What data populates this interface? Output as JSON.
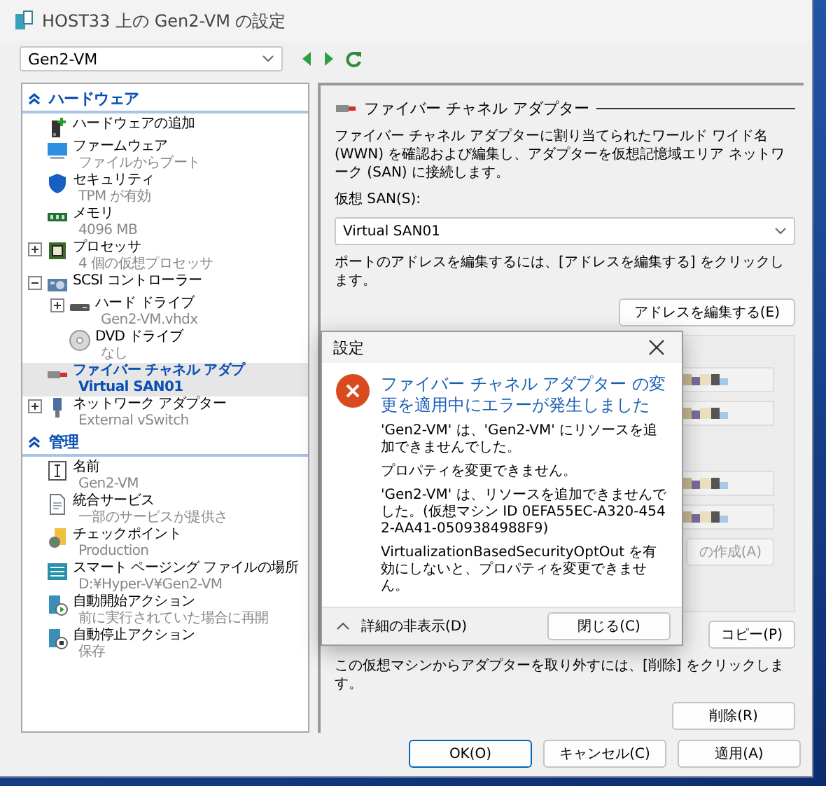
{
  "window": {
    "title": "HOST33 上の Gen2-VM の設定"
  },
  "vm_selector": {
    "value": "Gen2-VM"
  },
  "sidebar": {
    "sections": [
      {
        "title": "ハードウェア",
        "expanded": true,
        "items": [
          {
            "kind": "add-hardware",
            "label": "ハードウェアの追加",
            "selected": false
          },
          {
            "kind": "firmware",
            "label": "ファームウェア",
            "detail": "ファイルからブート",
            "selected": false
          },
          {
            "kind": "security",
            "label": "セキュリティ",
            "detail": "TPM が有効",
            "selected": false
          },
          {
            "kind": "memory",
            "label": "メモリ",
            "detail": "4096 MB",
            "selected": false
          },
          {
            "kind": "processor",
            "label": "プロセッサ",
            "detail": "4 個の仮想プロセッサ",
            "expanded": false,
            "selected": false
          },
          {
            "kind": "controller",
            "label": "SCSI コントローラー",
            "expanded": true,
            "selected": false,
            "children": [
              {
                "kind": "disk",
                "label": "ハード ドライブ",
                "detail": "Gen2-VM.vhdx",
                "expanded": false,
                "selected": false
              },
              {
                "kind": "dvd",
                "label": "DVD ドライブ",
                "detail": "なし",
                "selected": false
              }
            ]
          },
          {
            "kind": "fibre",
            "label": "ファイバー チャネル アダプ",
            "detail": "Virtual SAN01",
            "selected": true
          },
          {
            "kind": "network",
            "label": "ネットワーク アダプター",
            "detail": "External vSwitch",
            "expanded": false,
            "selected": false
          }
        ]
      },
      {
        "title": "管理",
        "expanded": true,
        "items": [
          {
            "kind": "name",
            "label": "名前",
            "detail": "Gen2-VM",
            "selected": false
          },
          {
            "kind": "service",
            "label": "統合サービス",
            "detail": "一部のサービスが提供さ",
            "selected": false
          },
          {
            "kind": "checkpoint",
            "label": "チェックポイント",
            "detail": "Production",
            "selected": false
          },
          {
            "kind": "paging",
            "label": "スマート ページング ファイルの場所",
            "detail": "D:¥Hyper-V¥Gen2-VM",
            "selected": false
          },
          {
            "kind": "start",
            "label": "自動開始アクション",
            "detail": "前に実行されていた場合に再開",
            "selected": false
          },
          {
            "kind": "stop",
            "label": "自動停止アクション",
            "detail": "保存",
            "selected": false
          }
        ]
      }
    ]
  },
  "adapter": {
    "title": "ファイバー チャネル アダプター",
    "description": "ファイバー チャネル アダプターに割り当てられたワールド ワイド名 (WWN) を確認および編集し、アダプターを仮想記憶域エリア ネットワーク (SAN) に接続します。",
    "san_label": "仮想 SAN(S):",
    "san_value": "Virtual SAN01",
    "address_hint": "ポートのアドレスを編集するには、[アドレスを編集する] をクリックします。",
    "edit_button": "アドレスを編集する(E)",
    "address_fields": [
      {
        "kind": "masked"
      },
      {
        "kind": "masked"
      },
      {
        "kind": "masked"
      },
      {
        "kind": "masked"
      }
    ],
    "create_button": {
      "label": "の作成(A)",
      "disabled": true
    },
    "copy_button": "コピー(P)",
    "remove_hint": "この仮想マシンからアダプターを取り外すには、[削除] をクリックします。",
    "remove_button": "削除(R)"
  },
  "dialog": {
    "title": "設定",
    "heading": "ファイバー チャネル アダプター の変更を適用中にエラーが発生しました",
    "messages": [
      "'Gen2-VM' は、'Gen2-VM' にリソースを追加できませんでした。",
      "プロパティを変更できません。",
      "'Gen2-VM' は、リソースを追加できませんでした。(仮想マシン ID 0EFA55EC-A320-4542-AA41-0509384988F9)",
      "VirtualizationBasedSecurityOptOut を有効にしないと、プロパティを変更できません。"
    ],
    "details_toggle": {
      "label": "詳細の非表示(D)",
      "expanded": true
    },
    "close_button": "閉じる(C)"
  },
  "buttons": [
    {
      "label": "OK(O)",
      "default": true
    },
    {
      "label": "キャンセル(C)",
      "default": false
    },
    {
      "label": "適用(A)",
      "default": false
    }
  ]
}
